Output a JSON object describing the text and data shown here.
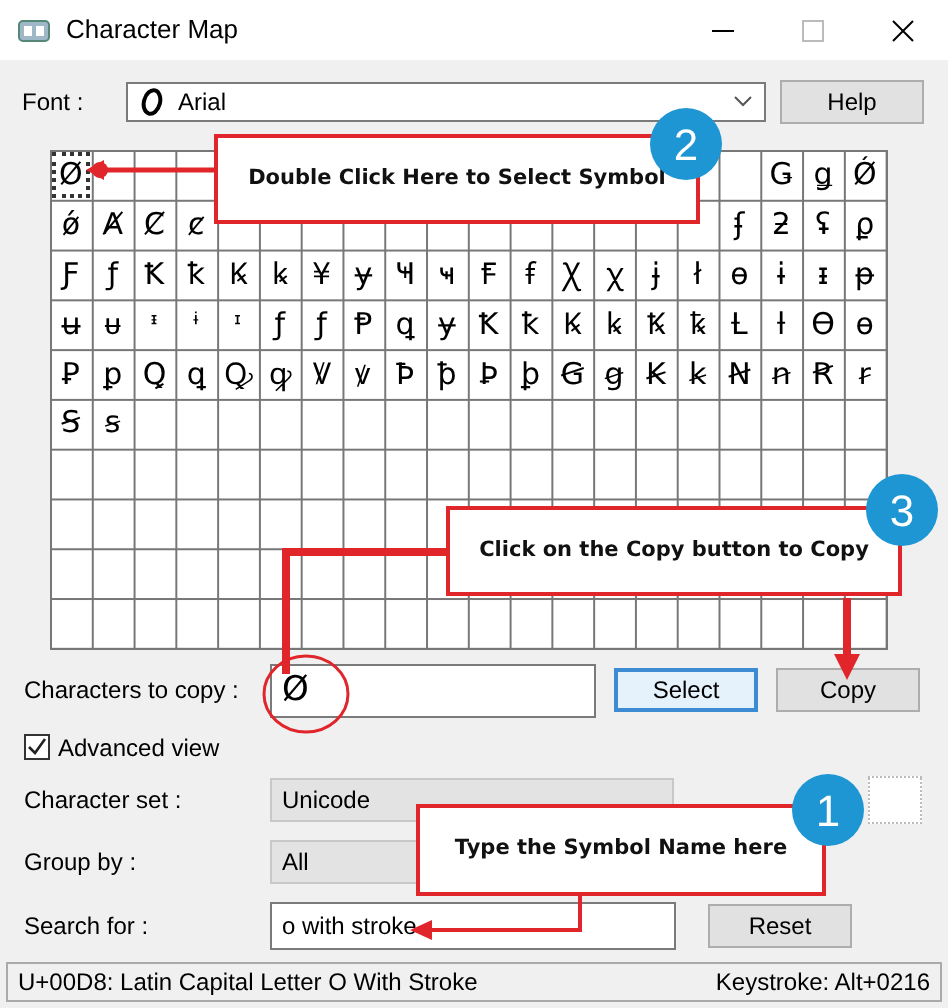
{
  "window": {
    "title": "Character Map"
  },
  "font": {
    "label": "Font :",
    "value": "Arial"
  },
  "help_button": "Help",
  "grid": {
    "rows": [
      [
        {
          "char": "Ø",
          "selected": true
        },
        null,
        null,
        null,
        null,
        null,
        null,
        null,
        null,
        null,
        null,
        null,
        null,
        null,
        null,
        null,
        null,
        {
          "char": "Ǥ",
          "selected": false
        },
        {
          "char": "ǥ",
          "selected": false
        },
        {
          "char": "Ǿ",
          "selected": false
        }
      ],
      [
        {
          "char": "ǿ",
          "selected": false
        },
        {
          "char": "Ⱥ",
          "selected": false
        },
        {
          "char": "Ȼ",
          "selected": false
        },
        {
          "char": "ȼ",
          "selected": false
        },
        null,
        null,
        null,
        null,
        null,
        null,
        null,
        null,
        null,
        null,
        null,
        null,
        {
          "char": "ʄ",
          "selected": false
        },
        {
          "char": "ƻ",
          "selected": false
        },
        {
          "char": "ʢ",
          "selected": false
        },
        {
          "char": "ϼ",
          "selected": false
        }
      ],
      [
        {
          "char": "Ƒ",
          "selected": false
        },
        {
          "char": "ƒ",
          "selected": false
        },
        {
          "char": "Ꝁ",
          "selected": false
        },
        {
          "char": "ꝁ",
          "selected": false
        },
        {
          "char": "Ꝃ",
          "selected": false
        },
        {
          "char": "ꝃ",
          "selected": false
        },
        {
          "char": "¥",
          "selected": false
        },
        {
          "char": "ɏ",
          "selected": false
        },
        {
          "char": "Ҹ",
          "selected": false
        },
        {
          "char": "ҹ",
          "selected": false
        },
        {
          "char": "Ꞙ",
          "selected": false
        },
        {
          "char": "ꞙ",
          "selected": false
        },
        {
          "char": "Ꭓ",
          "selected": false
        },
        {
          "char": "ꭓ",
          "selected": false
        },
        {
          "char": "ɉ",
          "selected": false
        },
        {
          "char": "ł",
          "selected": false
        },
        {
          "char": "ɵ",
          "selected": false
        },
        {
          "char": "ɨ",
          "selected": false
        },
        {
          "char": "ᵻ",
          "selected": false
        },
        {
          "char": "ᵽ",
          "selected": false
        }
      ],
      [
        {
          "char": "ʉ",
          "selected": false
        },
        {
          "char": "ᵾ",
          "selected": false
        },
        {
          "char": "ᶧ",
          "selected": false
        },
        {
          "char": "ᶤ",
          "selected": false
        },
        {
          "char": "ᶦ",
          "selected": false
        },
        {
          "char": "ƒ",
          "selected": false
        },
        {
          "char": "ƒ",
          "selected": false
        },
        {
          "char": "Ᵽ",
          "selected": false
        },
        {
          "char": "ꝗ",
          "selected": false
        },
        {
          "char": "ɏ",
          "selected": false
        },
        {
          "char": "Ꝁ",
          "selected": false
        },
        {
          "char": "ꝁ",
          "selected": false
        },
        {
          "char": "Ꝃ",
          "selected": false
        },
        {
          "char": "ꝃ",
          "selected": false
        },
        {
          "char": "Ꝅ",
          "selected": false
        },
        {
          "char": "ꝅ",
          "selected": false
        },
        {
          "char": "Ƚ",
          "selected": false
        },
        {
          "char": "ƚ",
          "selected": false
        },
        {
          "char": "Ɵ",
          "selected": false
        },
        {
          "char": "ɵ",
          "selected": false
        }
      ],
      [
        {
          "char": "Ꝑ",
          "selected": false
        },
        {
          "char": "ꝑ",
          "selected": false
        },
        {
          "char": "Ꝗ",
          "selected": false
        },
        {
          "char": "ꝗ",
          "selected": false
        },
        {
          "char": "Ꝙ",
          "selected": false
        },
        {
          "char": "ꝙ",
          "selected": false
        },
        {
          "char": "Ꝟ",
          "selected": false
        },
        {
          "char": "ꝟ",
          "selected": false
        },
        {
          "char": "Ꝥ",
          "selected": false
        },
        {
          "char": "ꝥ",
          "selected": false
        },
        {
          "char": "Ꝧ",
          "selected": false
        },
        {
          "char": "ꝧ",
          "selected": false
        },
        {
          "char": "Ꞡ",
          "selected": false
        },
        {
          "char": "ꞡ",
          "selected": false
        },
        {
          "char": "Ꞣ",
          "selected": false
        },
        {
          "char": "ꞣ",
          "selected": false
        },
        {
          "char": "Ꞥ",
          "selected": false
        },
        {
          "char": "ꞥ",
          "selected": false
        },
        {
          "char": "Ꞧ",
          "selected": false
        },
        {
          "char": "ꞧ",
          "selected": false
        }
      ],
      [
        {
          "char": "Ꞩ",
          "selected": false
        },
        {
          "char": "ꞩ",
          "selected": false
        }
      ]
    ]
  },
  "copy": {
    "label": "Characters to copy :",
    "value": "Ø"
  },
  "copy_buttons": [
    {
      "label": "Select",
      "focused": true
    },
    {
      "label": "Copy",
      "focused": false
    }
  ],
  "advanced_view": {
    "label": "Advanced view",
    "checked": true
  },
  "character_set": {
    "label": "Character set :",
    "value": "Unicode"
  },
  "group_by": {
    "label": "Group by :",
    "value": "All"
  },
  "search": {
    "label": "Search for :",
    "value": "o with stroke",
    "button": "Reset"
  },
  "status_bar": {
    "character": "U+00D8: Latin Capital Letter O With Stroke",
    "keystroke": "Keystroke: Alt+0216"
  },
  "callouts": [
    {
      "step": "2",
      "text": "Double Click Here to Select Symbol"
    },
    {
      "step": "3",
      "text": "Click on the Copy button to Copy"
    },
    {
      "step": "1",
      "text": "Type the Symbol Name here"
    }
  ]
}
